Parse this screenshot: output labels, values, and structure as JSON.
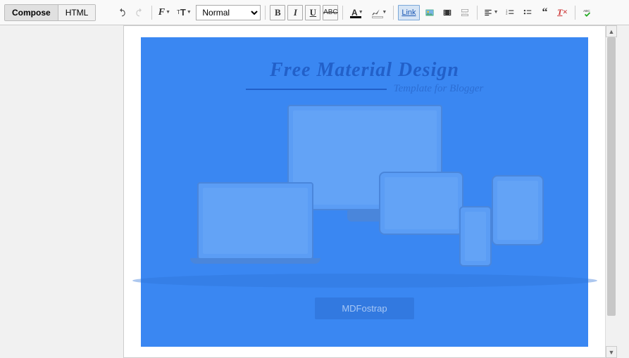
{
  "modes": {
    "compose": "Compose",
    "html": "HTML"
  },
  "font": {
    "selected": "Normal"
  },
  "link_label": "Link",
  "content": {
    "title": "Free Material Design",
    "subtitle": "Template for Blogger",
    "button": "MDFostrap"
  }
}
